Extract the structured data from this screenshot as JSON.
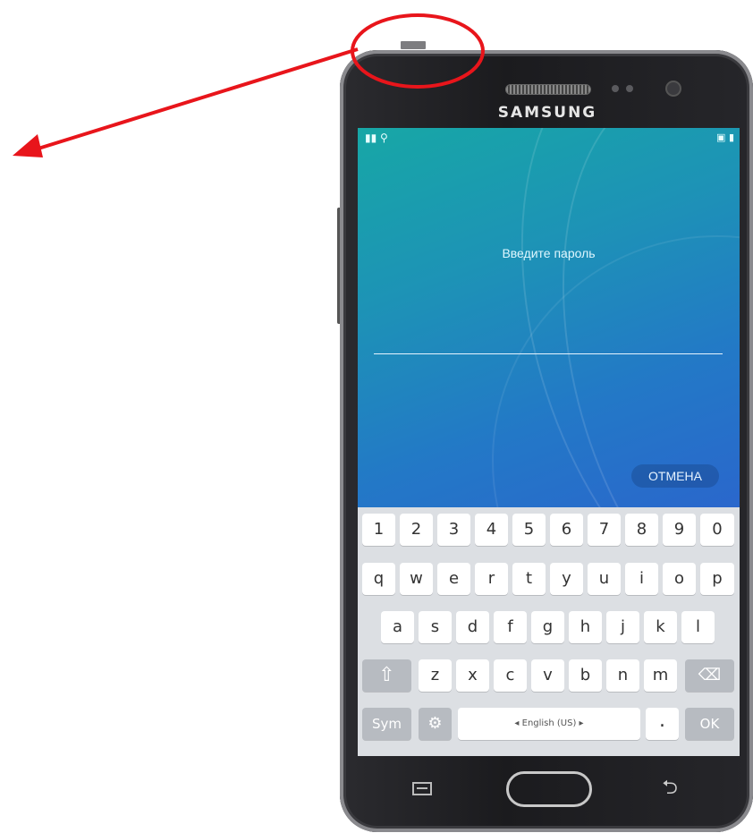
{
  "device": {
    "brand": "SAMSUNG"
  },
  "status_bar": {
    "left_icons": "signal-icon wifi-icon",
    "right_icons": "gallery-icon battery-icon"
  },
  "lock_screen": {
    "prompt": "Введите пароль",
    "password_value": "",
    "cancel_label": "ОТМЕНА"
  },
  "keyboard": {
    "rows": [
      [
        "1",
        "2",
        "3",
        "4",
        "5",
        "6",
        "7",
        "8",
        "9",
        "0"
      ],
      [
        "q",
        "w",
        "e",
        "r",
        "t",
        "y",
        "u",
        "i",
        "o",
        "p"
      ],
      [
        "a",
        "s",
        "d",
        "f",
        "g",
        "h",
        "j",
        "k",
        "l"
      ],
      [
        "z",
        "x",
        "c",
        "v",
        "b",
        "n",
        "m"
      ]
    ],
    "shift_label": "⇧",
    "backspace_label": "⌫",
    "sym_label": "Sym",
    "settings_label": "⚙",
    "space_label": "◂ English (US) ▸",
    "period_label": ".",
    "ok_label": "OK"
  },
  "nav": {
    "recent_icon": "recent-apps-icon",
    "home_icon": "home-button",
    "back_label": "⮌"
  },
  "annotation": {
    "color": "#e8151b"
  }
}
